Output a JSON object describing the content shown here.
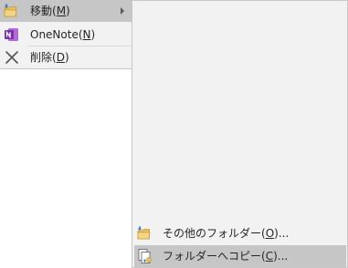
{
  "context_menu": {
    "items": [
      {
        "label_pre": "移動(",
        "accel": "M",
        "label_post": ")",
        "icon": "folder-move-icon",
        "highlighted": true,
        "has_submenu": true
      },
      {
        "label_pre": "OneNote(",
        "accel": "N",
        "label_post": ")",
        "icon": "onenote-icon",
        "highlighted": false
      },
      {
        "label_pre": "削除(",
        "accel": "D",
        "label_post": ")",
        "icon": "delete-icon",
        "highlighted": false
      }
    ]
  },
  "submenu": {
    "items": [
      {
        "label_pre": "その他のフォルダー(",
        "accel": "O",
        "label_post": ")...",
        "icon": "folder-other-icon",
        "highlighted": false
      },
      {
        "label_pre": "フォルダーへコピー(",
        "accel": "C",
        "label_post": ")...",
        "icon": "copy-to-folder-icon",
        "highlighted": true
      }
    ]
  },
  "colors": {
    "menu_bg": "#f2f2f2",
    "highlight": "#c6c6c6",
    "onenote_purple": "#7b2fa8",
    "folder_yellow": "#e8c063"
  }
}
